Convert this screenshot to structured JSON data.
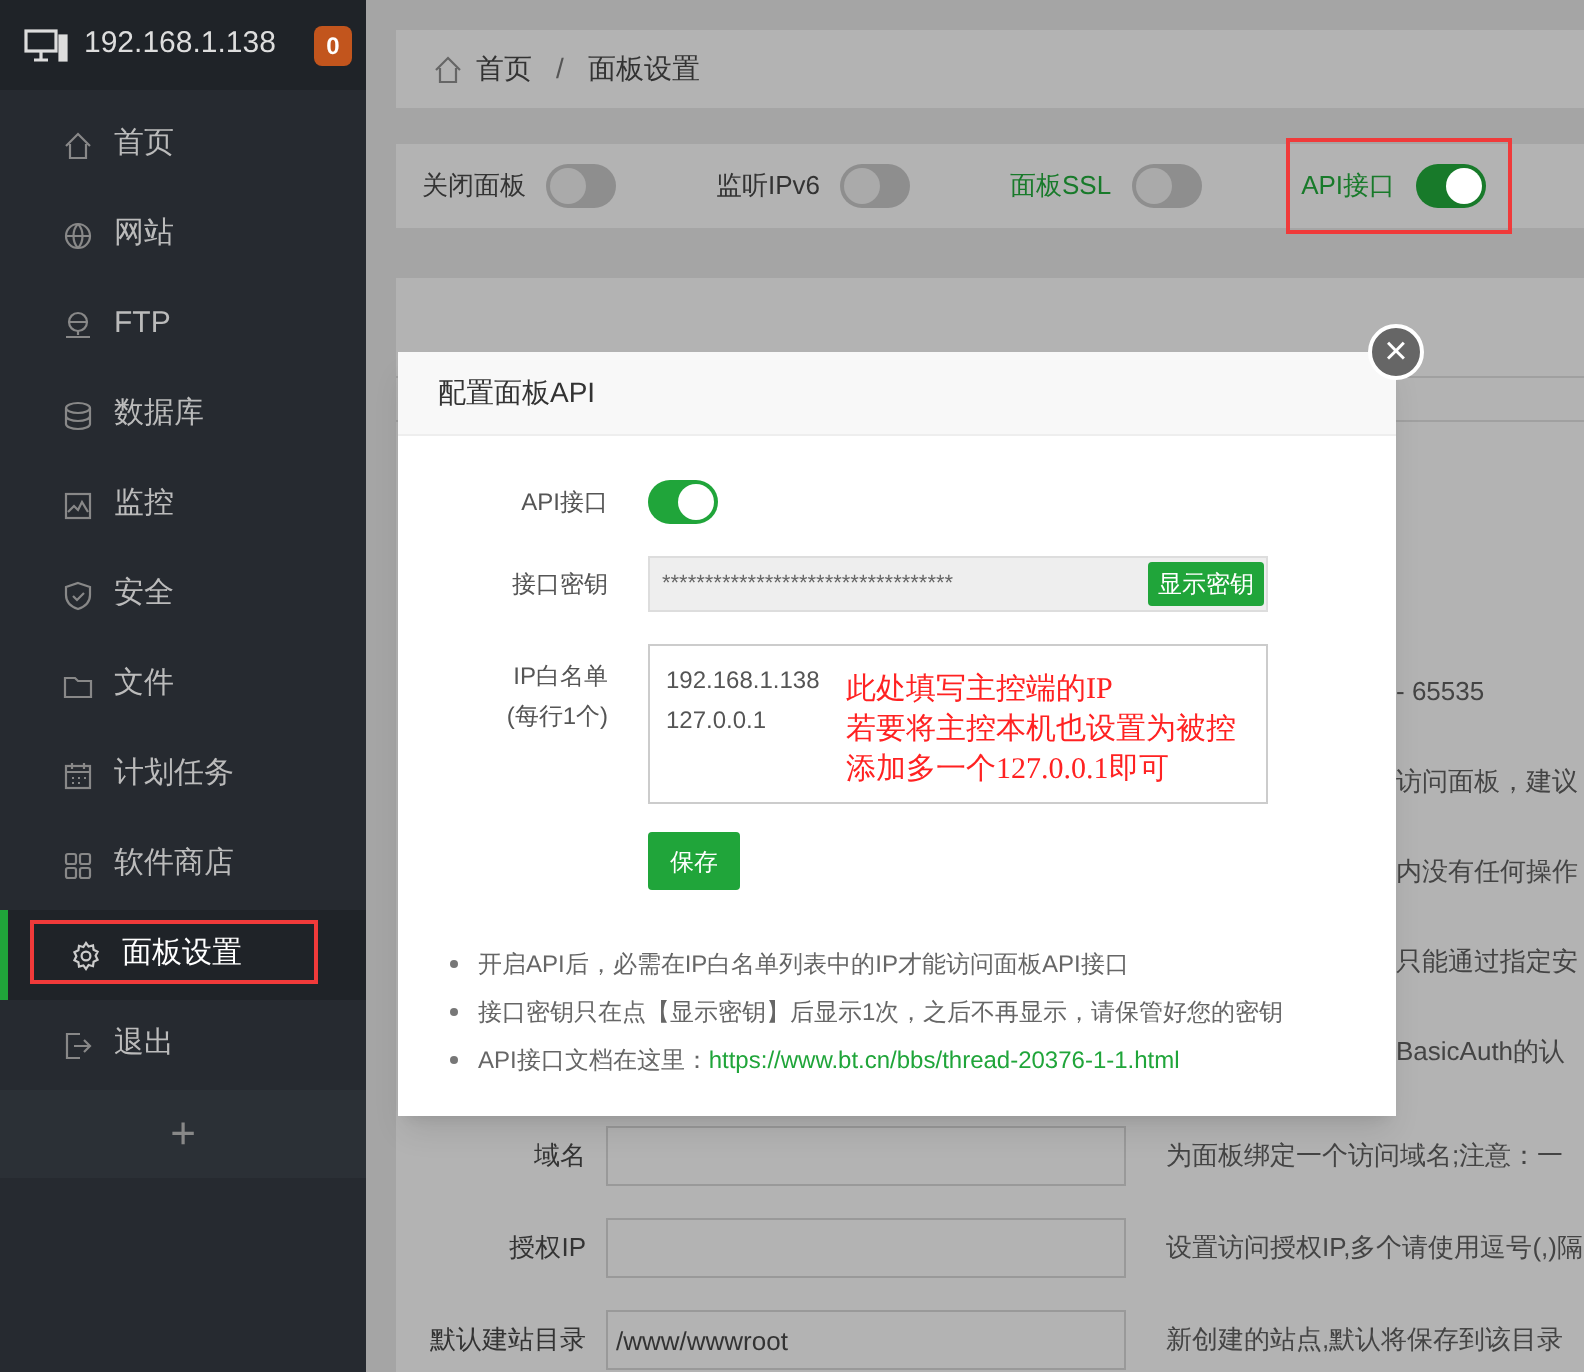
{
  "sidebar": {
    "host": "192.168.1.138",
    "badge": "0",
    "items": [
      {
        "label": "首页",
        "selected": false
      },
      {
        "label": "网站",
        "selected": false
      },
      {
        "label": "FTP",
        "selected": false
      },
      {
        "label": "数据库",
        "selected": false
      },
      {
        "label": "监控",
        "selected": false
      },
      {
        "label": "安全",
        "selected": false
      },
      {
        "label": "文件",
        "selected": false
      },
      {
        "label": "计划任务",
        "selected": false
      },
      {
        "label": "软件商店",
        "selected": false
      },
      {
        "label": "面板设置",
        "selected": true,
        "highlighted": true
      },
      {
        "label": "退出",
        "selected": false
      }
    ],
    "add_button": "+"
  },
  "breadcrumb": [
    "首页",
    "面板设置"
  ],
  "breadcrumb_separator": "/",
  "toggles": [
    {
      "label": "关闭面板",
      "on": false,
      "green_label": false,
      "highlighted": false
    },
    {
      "label": "监听IPv6",
      "on": false,
      "green_label": false,
      "highlighted": false
    },
    {
      "label": "面板SSL",
      "on": false,
      "green_label": true,
      "highlighted": false
    },
    {
      "label": "API接口",
      "on": true,
      "green_label": true,
      "highlighted": true
    }
  ],
  "background_hints": [
    "- 65535",
    "访问面板，建议",
    "内没有任何操作",
    "只能通过指定安",
    "BasicAuth的认"
  ],
  "background_rows": [
    {
      "label": "域名",
      "value": "",
      "hint": "为面板绑定一个访问域名;注意：一"
    },
    {
      "label": "授权IP",
      "value": "",
      "hint": "设置访问授权IP,多个请使用逗号(,)隔"
    },
    {
      "label": "默认建站目录",
      "value": "/www/wwwroot",
      "hint": "新创建的站点,默认将保存到该目录"
    }
  ],
  "dialog": {
    "title": "配置面板API",
    "close": "×",
    "api": {
      "label": "API接口",
      "on": true
    },
    "key": {
      "label": "接口密钥",
      "value": "**********************************",
      "button": "显示密钥"
    },
    "whitelist": {
      "label": "IP白名单",
      "sublabel": "(每行1个)",
      "value": "192.168.1.138\n127.0.0.1",
      "annotation": [
        "此处填写主控端的IP",
        "若要将主控本机也设置为被控",
        "添加多一个127.0.0.1即可"
      ]
    },
    "save": "保存",
    "notes": [
      {
        "text": "开启API后，必需在IP白名单列表中的IP才能访问面板API接口"
      },
      {
        "text": "接口密钥只在点【显示密钥】后显示1次，之后不再显示，请保管好您的密钥"
      },
      {
        "text": "API接口文档在这里：",
        "link": "https://www.bt.cn/bbs/thread-20376-1-1.html"
      }
    ]
  }
}
